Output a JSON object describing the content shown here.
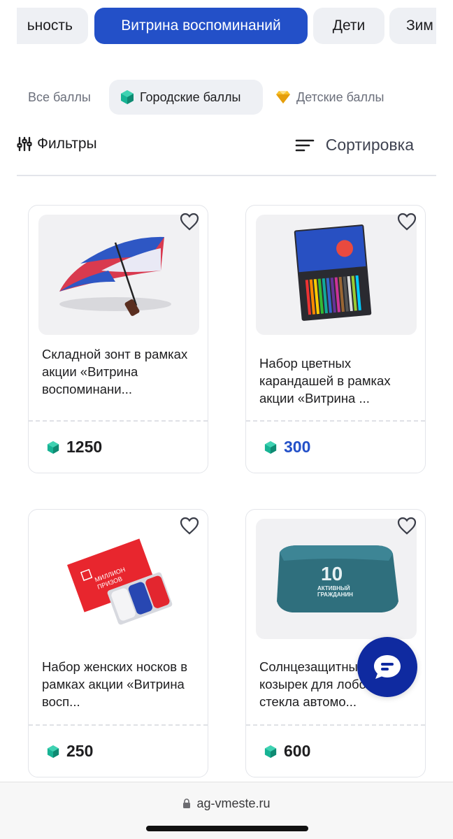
{
  "category_tabs": [
    {
      "label": "ьность",
      "active": false
    },
    {
      "label": "Витрина воспоминаний",
      "active": true
    },
    {
      "label": "Дети",
      "active": false
    },
    {
      "label": "Зим",
      "active": false
    }
  ],
  "points_filter": {
    "all": "Все баллы",
    "city": "Городские баллы",
    "kids": "Детские баллы"
  },
  "toolbar": {
    "filters_label": "Фильтры",
    "sort_label": "Сортировка"
  },
  "products": [
    {
      "title": "Складной зонт в рамках акции «Витрина воспоминани...",
      "price": "1250",
      "highlight": false
    },
    {
      "title": "Набор цветных карандашей в рамках акции «Витрина ...",
      "price": "300",
      "highlight": true
    },
    {
      "title": "Набор женских носков в рамках акции «Витрина восп...",
      "price": "250",
      "highlight": false
    },
    {
      "title": "Солнцезащитный козырек для лобового стекла автомо...",
      "price": "600",
      "highlight": false
    }
  ],
  "image_text": {
    "socks_box_brand": "МИЛЛИОН\nПРИЗОВ",
    "shade_number": "10",
    "shade_caption": "АКТИВНЫЙ\nГРАЖДАНИН"
  },
  "browser": {
    "url": "ag-vmeste.ru"
  },
  "colors": {
    "accent": "#2350c8",
    "chip_bg": "#eef0f4",
    "city_gem": "#19a68c",
    "kids_gem": "#f2b418",
    "chat_fab": "#0f2aa0"
  }
}
